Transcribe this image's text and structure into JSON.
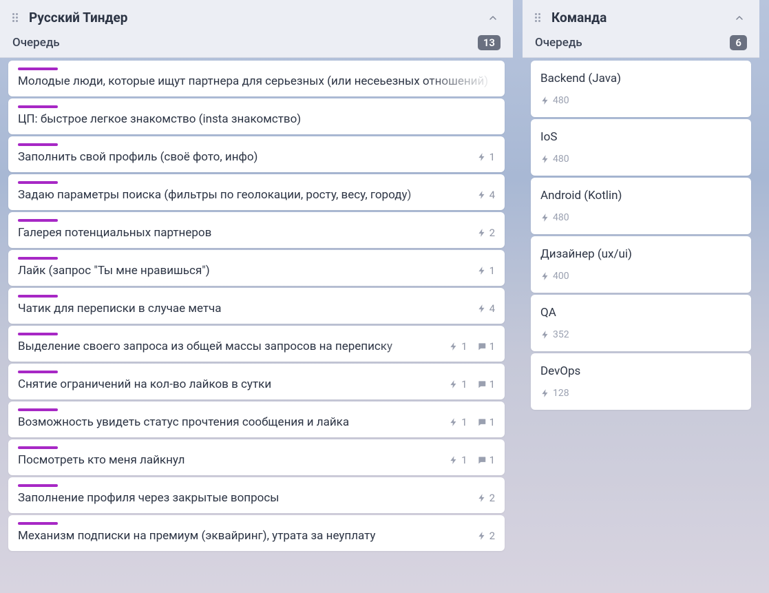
{
  "columns": {
    "left": {
      "title": "Русский Тиндер",
      "subLabel": "Очередь",
      "count": "13",
      "cards": [
        {
          "tag": true,
          "text": "Молодые люди, которые ищут партнера для серьезных (или несеьезных отношений)",
          "bolt": null,
          "comment": null
        },
        {
          "tag": true,
          "text": "ЦП: быстрое легкое знакомство (insta знакомство)",
          "bolt": null,
          "comment": null
        },
        {
          "tag": true,
          "text": "Заполнить свой профиль (своё фото, инфо)",
          "bolt": "1",
          "comment": null
        },
        {
          "tag": true,
          "text": "Задаю параметры поиска (фильтры по геолокации, росту, весу, городу)",
          "bolt": "4",
          "comment": null
        },
        {
          "tag": true,
          "text": "Галерея потенциальных партнеров",
          "bolt": "2",
          "comment": null
        },
        {
          "tag": true,
          "text": "Лайк (запрос \"Ты мне нравишься\")",
          "bolt": "1",
          "comment": null
        },
        {
          "tag": true,
          "text": "Чатик для переписки в случае метча",
          "bolt": "4",
          "comment": null
        },
        {
          "tag": true,
          "text": "Выделение своего запроса из общей массы запросов на переписку",
          "bolt": "1",
          "comment": "1"
        },
        {
          "tag": true,
          "text": "Снятие ограничений на кол-во лайков в сутки",
          "bolt": "1",
          "comment": "1"
        },
        {
          "tag": true,
          "text": "Возможность увидеть статус прочтения сообщения и лайка",
          "bolt": "1",
          "comment": "1"
        },
        {
          "tag": true,
          "text": "Посмотреть кто меня лайкнул",
          "bolt": "1",
          "comment": "1"
        },
        {
          "tag": true,
          "text": "Заполнение профиля через закрытые вопросы",
          "bolt": "2",
          "comment": null
        },
        {
          "tag": true,
          "text": "Механизм подписки на премиум (эквайринг), утрата за неуплату",
          "bolt": "2",
          "comment": null
        }
      ]
    },
    "right": {
      "title": "Команда",
      "subLabel": "Очередь",
      "count": "6",
      "cards": [
        {
          "text": "Backend (Java)",
          "bolt": "480"
        },
        {
          "text": "IoS",
          "bolt": "480"
        },
        {
          "text": "Android (Kotlin)",
          "bolt": "480"
        },
        {
          "text": "Дизайнер (ux/ui)",
          "bolt": "400"
        },
        {
          "text": "QA",
          "bolt": "352"
        },
        {
          "text": "DevOps",
          "bolt": "128"
        }
      ]
    }
  }
}
